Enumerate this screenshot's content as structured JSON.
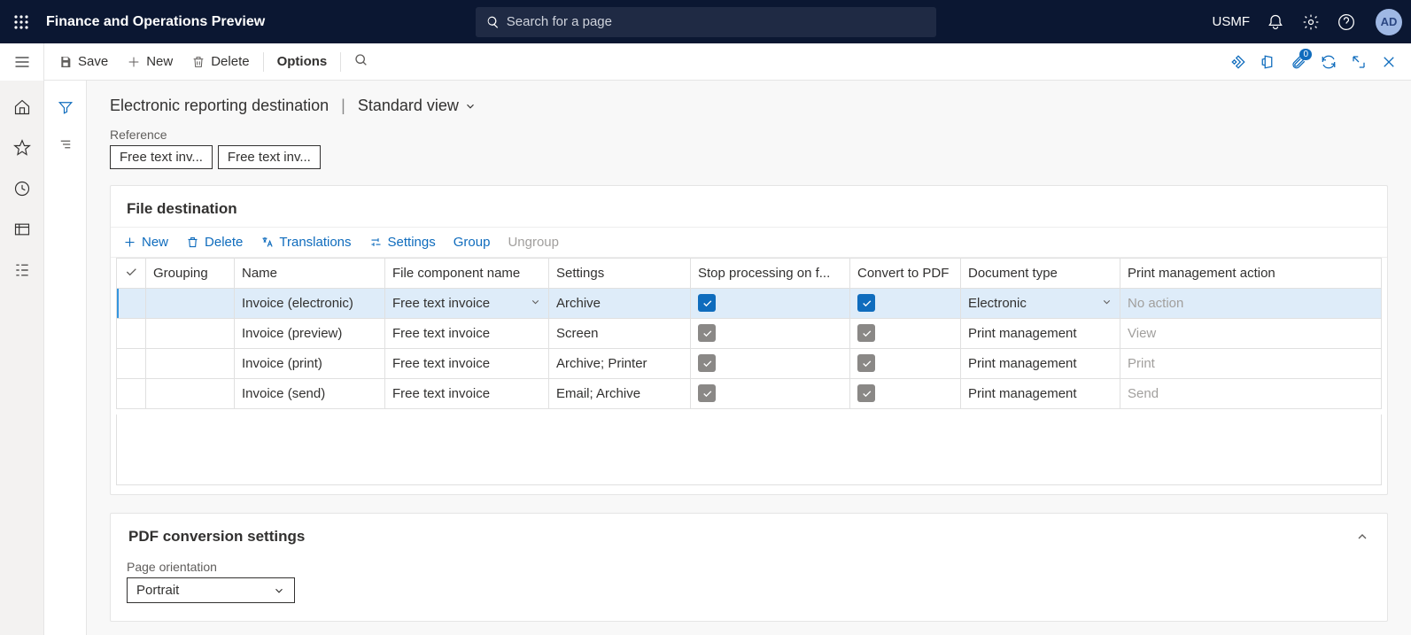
{
  "topbar": {
    "app_title": "Finance and Operations Preview",
    "search_placeholder": "Search for a page",
    "entity": "USMF",
    "avatar": "AD"
  },
  "actionbar": {
    "save": "Save",
    "new": "New",
    "delete": "Delete",
    "options": "Options",
    "attach_badge": "0"
  },
  "header": {
    "title": "Electronic reporting destination",
    "view": "Standard view"
  },
  "reference": {
    "label": "Reference",
    "box1": "Free text inv...",
    "box2": "Free text inv..."
  },
  "file_destination": {
    "title": "File destination",
    "toolbar": {
      "new": "New",
      "delete": "Delete",
      "translations": "Translations",
      "settings": "Settings",
      "group": "Group",
      "ungroup": "Ungroup"
    },
    "columns": {
      "grouping": "Grouping",
      "name": "Name",
      "file_component": "File component name",
      "settings": "Settings",
      "stop": "Stop processing on f...",
      "convert": "Convert to PDF",
      "doctype": "Document type",
      "pm_action": "Print management action"
    },
    "rows": [
      {
        "name": "Invoice (electronic)",
        "file_component": "Free text invoice",
        "settings": "Archive",
        "stop": true,
        "stop_style": "blue",
        "convert": true,
        "convert_style": "blue",
        "doctype": "Electronic",
        "pm_action": "No action",
        "pm_disabled": true,
        "selected": true
      },
      {
        "name": "Invoice (preview)",
        "file_component": "Free text invoice",
        "settings": "Screen",
        "stop": true,
        "stop_style": "gray",
        "convert": true,
        "convert_style": "gray",
        "doctype": "Print management",
        "pm_action": "View",
        "pm_disabled": true
      },
      {
        "name": "Invoice (print)",
        "file_component": "Free text invoice",
        "settings": "Archive; Printer",
        "stop": true,
        "stop_style": "gray",
        "convert": true,
        "convert_style": "gray",
        "doctype": "Print management",
        "pm_action": "Print",
        "pm_disabled": true
      },
      {
        "name": "Invoice (send)",
        "file_component": "Free text invoice",
        "settings": "Email; Archive",
        "stop": true,
        "stop_style": "gray",
        "convert": true,
        "convert_style": "gray",
        "doctype": "Print management",
        "pm_action": "Send",
        "pm_disabled": true
      }
    ]
  },
  "pdf_settings": {
    "title": "PDF conversion settings",
    "orientation_label": "Page orientation",
    "orientation_value": "Portrait"
  }
}
